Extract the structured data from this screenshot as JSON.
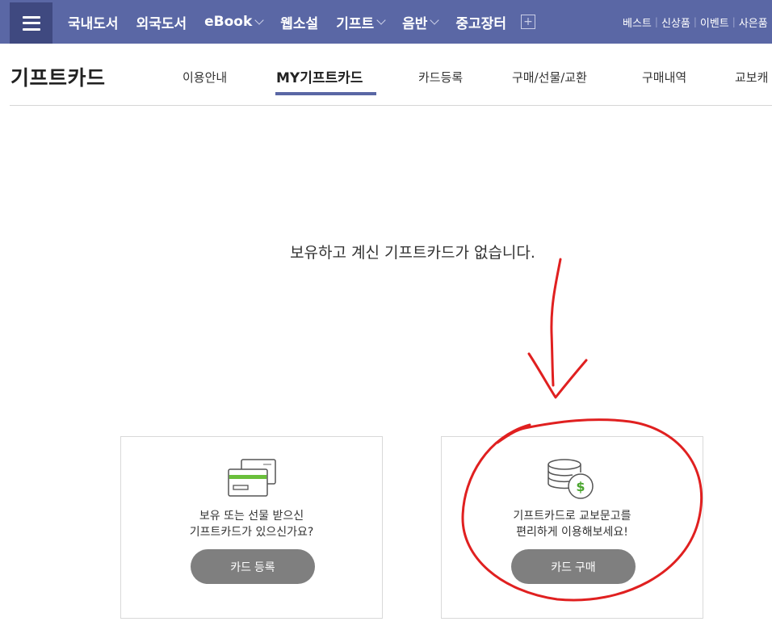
{
  "topnav": {
    "menu_icon": "hamburger-icon",
    "items": [
      {
        "label": "국내도서",
        "has_dropdown": false
      },
      {
        "label": "외국도서",
        "has_dropdown": false
      },
      {
        "label": "eBook",
        "has_dropdown": true
      },
      {
        "label": "웹소설",
        "has_dropdown": false
      },
      {
        "label": "기프트",
        "has_dropdown": true
      },
      {
        "label": "음반",
        "has_dropdown": true
      },
      {
        "label": "중고장터",
        "has_dropdown": false
      }
    ],
    "more_icon": "plus-box-icon",
    "sub_items": [
      "베스트",
      "신상품",
      "이벤트",
      "사은품"
    ],
    "bg_color": "#5a67a5"
  },
  "page": {
    "title": "기프트카드",
    "tabs": [
      "이용안내",
      "MY기프트카드",
      "카드등록",
      "구매/선물/교환",
      "구매내역",
      "교보캐"
    ],
    "active_tab": "MY기프트카드"
  },
  "main": {
    "empty_message": "보유하고 계신 기프트카드가 없습니다."
  },
  "cards": {
    "register": {
      "icon": "credit-card-icon",
      "line1": "보유 또는 선물 받으신",
      "line2": "기프트카드가 있으신가요?",
      "button": "카드 등록"
    },
    "purchase": {
      "icon": "coin-stack-dollar-icon",
      "line1": "기프트카드로 교보문고를",
      "line2": "편리하게 이용해보세요!",
      "button": "카드 구매"
    }
  },
  "annotation_color": "#e02020"
}
